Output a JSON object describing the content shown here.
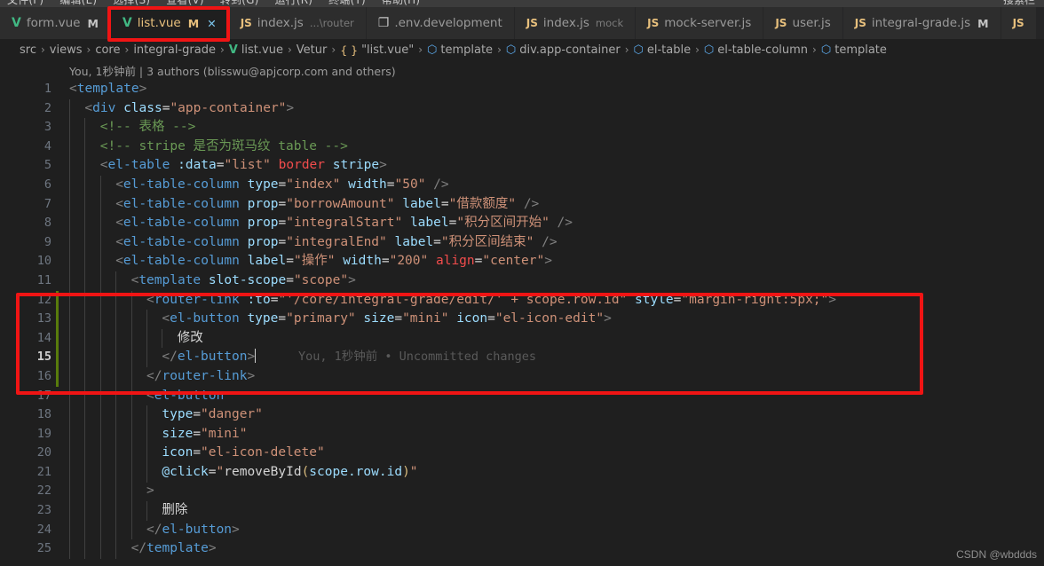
{
  "menubar": {
    "items": [
      "文件(F)",
      "编辑(E)",
      "选择(S)",
      "查看(V)",
      "转到(G)",
      "运行(R)",
      "终端(T)",
      "帮助(H)"
    ],
    "right_label": "搜索栏"
  },
  "tabs": [
    {
      "icon": "vue-icon",
      "name": "form.vue",
      "desc": "",
      "dirty": "M",
      "active": false,
      "closable": false
    },
    {
      "icon": "vue-icon",
      "name": "list.vue",
      "desc": "",
      "dirty": "M",
      "active": true,
      "closable": true,
      "close_label": "✕"
    },
    {
      "icon": "js-icon",
      "name": "index.js",
      "desc": "...\\router",
      "dirty": "",
      "active": false,
      "closable": false
    },
    {
      "icon": "file-icon",
      "name": ".env.development",
      "desc": "",
      "dirty": "",
      "active": false,
      "closable": false
    },
    {
      "icon": "js-icon",
      "name": "index.js",
      "desc": "mock",
      "dirty": "",
      "active": false,
      "closable": false
    },
    {
      "icon": "js-icon",
      "name": "mock-server.js",
      "desc": "",
      "dirty": "",
      "active": false,
      "closable": false
    },
    {
      "icon": "js-icon",
      "name": "user.js",
      "desc": "",
      "dirty": "",
      "active": false,
      "closable": false
    },
    {
      "icon": "js-icon",
      "name": "integral-grade.js",
      "desc": "",
      "dirty": "M",
      "active": false,
      "closable": false
    },
    {
      "icon": "js-icon",
      "name": "",
      "desc": "",
      "dirty": "",
      "active": false,
      "closable": false
    }
  ],
  "breadcrumbs": [
    {
      "glyph": "",
      "label": "src"
    },
    {
      "glyph": "",
      "label": "views"
    },
    {
      "glyph": "",
      "label": "core"
    },
    {
      "glyph": "",
      "label": "integral-grade"
    },
    {
      "glyph": "vue",
      "label": "list.vue"
    },
    {
      "glyph": "",
      "label": "Vetur"
    },
    {
      "glyph": "brace",
      "label": "\"list.vue\""
    },
    {
      "glyph": "cube",
      "label": "template"
    },
    {
      "glyph": "cube",
      "label": "div.app-container"
    },
    {
      "glyph": "cube",
      "label": "el-table"
    },
    {
      "glyph": "cube",
      "label": "el-table-column"
    },
    {
      "glyph": "cube",
      "label": "template"
    }
  ],
  "breadcrumb_separator": "›",
  "blame": {
    "text": "You, 1秒钟前 | 3 authors (blisswu@apjcorp.com and others)"
  },
  "editor": {
    "inline_blame": "You, 1秒钟前 • Uncommitted changes",
    "current_line": 15,
    "lines": [
      {
        "n": 1,
        "git": false,
        "indent": 0,
        "tokens": [
          {
            "c": "brk",
            "t": "<"
          },
          {
            "c": "tag",
            "t": "template"
          },
          {
            "c": "brk",
            "t": ">"
          }
        ]
      },
      {
        "n": 2,
        "git": false,
        "indent": 1,
        "tokens": [
          {
            "c": "brk",
            "t": "<"
          },
          {
            "c": "tag",
            "t": "div"
          },
          {
            "c": "txt",
            "t": " "
          },
          {
            "c": "attr",
            "t": "class"
          },
          {
            "c": "op",
            "t": "="
          },
          {
            "c": "str",
            "t": "\"app-container\""
          },
          {
            "c": "brk",
            "t": ">"
          }
        ]
      },
      {
        "n": 3,
        "git": false,
        "indent": 2,
        "tokens": [
          {
            "c": "cmt",
            "t": "<!-- 表格 -->"
          }
        ]
      },
      {
        "n": 4,
        "git": false,
        "indent": 2,
        "tokens": [
          {
            "c": "cmt",
            "t": "<!-- stripe 是否为斑马纹 table -->"
          }
        ]
      },
      {
        "n": 5,
        "git": false,
        "indent": 2,
        "tokens": [
          {
            "c": "brk",
            "t": "<"
          },
          {
            "c": "tag",
            "t": "el-table"
          },
          {
            "c": "txt",
            "t": " "
          },
          {
            "c": "attr",
            "t": ":data"
          },
          {
            "c": "op",
            "t": "="
          },
          {
            "c": "str",
            "t": "\"list\""
          },
          {
            "c": "txt",
            "t": " "
          },
          {
            "c": "attr2",
            "t": "border"
          },
          {
            "c": "txt",
            "t": " "
          },
          {
            "c": "attr",
            "t": "stripe"
          },
          {
            "c": "brk",
            "t": ">"
          }
        ]
      },
      {
        "n": 6,
        "git": false,
        "indent": 3,
        "tokens": [
          {
            "c": "brk",
            "t": "<"
          },
          {
            "c": "tag",
            "t": "el-table-column"
          },
          {
            "c": "txt",
            "t": " "
          },
          {
            "c": "attr",
            "t": "type"
          },
          {
            "c": "op",
            "t": "="
          },
          {
            "c": "str",
            "t": "\"index\""
          },
          {
            "c": "txt",
            "t": " "
          },
          {
            "c": "attr",
            "t": "width"
          },
          {
            "c": "op",
            "t": "="
          },
          {
            "c": "str",
            "t": "\"50\""
          },
          {
            "c": "txt",
            "t": " "
          },
          {
            "c": "brk",
            "t": "/>"
          }
        ]
      },
      {
        "n": 7,
        "git": false,
        "indent": 3,
        "tokens": [
          {
            "c": "brk",
            "t": "<"
          },
          {
            "c": "tag",
            "t": "el-table-column"
          },
          {
            "c": "txt",
            "t": " "
          },
          {
            "c": "attr",
            "t": "prop"
          },
          {
            "c": "op",
            "t": "="
          },
          {
            "c": "str",
            "t": "\"borrowAmount\""
          },
          {
            "c": "txt",
            "t": " "
          },
          {
            "c": "attr",
            "t": "label"
          },
          {
            "c": "op",
            "t": "="
          },
          {
            "c": "str",
            "t": "\"借款额度\""
          },
          {
            "c": "txt",
            "t": " "
          },
          {
            "c": "brk",
            "t": "/>"
          }
        ]
      },
      {
        "n": 8,
        "git": false,
        "indent": 3,
        "tokens": [
          {
            "c": "brk",
            "t": "<"
          },
          {
            "c": "tag",
            "t": "el-table-column"
          },
          {
            "c": "txt",
            "t": " "
          },
          {
            "c": "attr",
            "t": "prop"
          },
          {
            "c": "op",
            "t": "="
          },
          {
            "c": "str",
            "t": "\"integralStart\""
          },
          {
            "c": "txt",
            "t": " "
          },
          {
            "c": "attr",
            "t": "label"
          },
          {
            "c": "op",
            "t": "="
          },
          {
            "c": "str",
            "t": "\"积分区间开始\""
          },
          {
            "c": "txt",
            "t": " "
          },
          {
            "c": "brk",
            "t": "/>"
          }
        ]
      },
      {
        "n": 9,
        "git": false,
        "indent": 3,
        "tokens": [
          {
            "c": "brk",
            "t": "<"
          },
          {
            "c": "tag",
            "t": "el-table-column"
          },
          {
            "c": "txt",
            "t": " "
          },
          {
            "c": "attr",
            "t": "prop"
          },
          {
            "c": "op",
            "t": "="
          },
          {
            "c": "str",
            "t": "\"integralEnd\""
          },
          {
            "c": "txt",
            "t": " "
          },
          {
            "c": "attr",
            "t": "label"
          },
          {
            "c": "op",
            "t": "="
          },
          {
            "c": "str",
            "t": "\"积分区间结束\""
          },
          {
            "c": "txt",
            "t": " "
          },
          {
            "c": "brk",
            "t": "/>"
          }
        ]
      },
      {
        "n": 10,
        "git": false,
        "indent": 3,
        "tokens": [
          {
            "c": "brk",
            "t": "<"
          },
          {
            "c": "tag",
            "t": "el-table-column"
          },
          {
            "c": "txt",
            "t": " "
          },
          {
            "c": "attr",
            "t": "label"
          },
          {
            "c": "op",
            "t": "="
          },
          {
            "c": "str",
            "t": "\"操作\""
          },
          {
            "c": "txt",
            "t": " "
          },
          {
            "c": "attr",
            "t": "width"
          },
          {
            "c": "op",
            "t": "="
          },
          {
            "c": "str",
            "t": "\"200\""
          },
          {
            "c": "txt",
            "t": " "
          },
          {
            "c": "attr2",
            "t": "align"
          },
          {
            "c": "op",
            "t": "="
          },
          {
            "c": "str",
            "t": "\"center\""
          },
          {
            "c": "brk",
            "t": ">"
          }
        ]
      },
      {
        "n": 11,
        "git": false,
        "indent": 4,
        "tokens": [
          {
            "c": "brk",
            "t": "<"
          },
          {
            "c": "tag",
            "t": "template"
          },
          {
            "c": "txt",
            "t": " "
          },
          {
            "c": "attr",
            "t": "slot-scope"
          },
          {
            "c": "op",
            "t": "="
          },
          {
            "c": "str",
            "t": "\"scope\""
          },
          {
            "c": "brk",
            "t": ">"
          }
        ]
      },
      {
        "n": 12,
        "git": true,
        "indent": 5,
        "tokens": [
          {
            "c": "brk",
            "t": "<"
          },
          {
            "c": "tag",
            "t": "router-link"
          },
          {
            "c": "txt",
            "t": " "
          },
          {
            "c": "attr",
            "t": ":to"
          },
          {
            "c": "op",
            "t": "="
          },
          {
            "c": "str",
            "t": "\"'/core/integral-grade/edit/' + scope.row.id\""
          },
          {
            "c": "txt",
            "t": " "
          },
          {
            "c": "attr",
            "t": "style"
          },
          {
            "c": "op",
            "t": "="
          },
          {
            "c": "str",
            "t": "\"margin-right:5px;\""
          },
          {
            "c": "brk",
            "t": ">"
          }
        ]
      },
      {
        "n": 13,
        "git": true,
        "indent": 6,
        "tokens": [
          {
            "c": "brk",
            "t": "<"
          },
          {
            "c": "tag",
            "t": "el-button"
          },
          {
            "c": "txt",
            "t": " "
          },
          {
            "c": "attr",
            "t": "type"
          },
          {
            "c": "op",
            "t": "="
          },
          {
            "c": "str",
            "t": "\"primary\""
          },
          {
            "c": "txt",
            "t": " "
          },
          {
            "c": "attr",
            "t": "size"
          },
          {
            "c": "op",
            "t": "="
          },
          {
            "c": "str",
            "t": "\"mini\""
          },
          {
            "c": "txt",
            "t": " "
          },
          {
            "c": "attr",
            "t": "icon"
          },
          {
            "c": "op",
            "t": "="
          },
          {
            "c": "str",
            "t": "\"el-icon-edit\""
          },
          {
            "c": "brk",
            "t": ">"
          }
        ]
      },
      {
        "n": 14,
        "git": true,
        "indent": 7,
        "tokens": [
          {
            "c": "txt",
            "t": "修改"
          }
        ]
      },
      {
        "n": 15,
        "git": true,
        "indent": 6,
        "tokens": [
          {
            "c": "brk",
            "t": "</"
          },
          {
            "c": "tag",
            "t": "el-button"
          },
          {
            "c": "brk",
            "t": ">"
          }
        ],
        "caret": true,
        "blame": true
      },
      {
        "n": 16,
        "git": true,
        "indent": 5,
        "tokens": [
          {
            "c": "brk",
            "t": "</"
          },
          {
            "c": "tag",
            "t": "router-link"
          },
          {
            "c": "brk",
            "t": ">"
          }
        ]
      },
      {
        "n": 17,
        "git": false,
        "indent": 5,
        "tokens": [
          {
            "c": "brk",
            "t": "<"
          },
          {
            "c": "tag",
            "t": "el-button"
          }
        ]
      },
      {
        "n": 18,
        "git": false,
        "indent": 6,
        "tokens": [
          {
            "c": "attr",
            "t": "type"
          },
          {
            "c": "op",
            "t": "="
          },
          {
            "c": "str",
            "t": "\"danger\""
          }
        ]
      },
      {
        "n": 19,
        "git": false,
        "indent": 6,
        "tokens": [
          {
            "c": "attr",
            "t": "size"
          },
          {
            "c": "op",
            "t": "="
          },
          {
            "c": "str",
            "t": "\"mini\""
          }
        ]
      },
      {
        "n": 20,
        "git": false,
        "indent": 6,
        "tokens": [
          {
            "c": "attr",
            "t": "icon"
          },
          {
            "c": "op",
            "t": "="
          },
          {
            "c": "str",
            "t": "\"el-icon-delete\""
          }
        ]
      },
      {
        "n": 21,
        "git": false,
        "indent": 6,
        "tokens": [
          {
            "c": "attr",
            "t": "@click"
          },
          {
            "c": "op",
            "t": "="
          },
          {
            "c": "str",
            "t": "\""
          },
          {
            "c": "txt",
            "t": "removeById"
          },
          {
            "c": "paren",
            "t": "("
          },
          {
            "c": "prop",
            "t": "scope.row.id"
          },
          {
            "c": "paren",
            "t": ")"
          },
          {
            "c": "str",
            "t": "\""
          }
        ]
      },
      {
        "n": 22,
        "git": false,
        "indent": 5,
        "tokens": [
          {
            "c": "brk",
            "t": ">"
          }
        ]
      },
      {
        "n": 23,
        "git": false,
        "indent": 6,
        "tokens": [
          {
            "c": "txt",
            "t": "删除"
          }
        ]
      },
      {
        "n": 24,
        "git": false,
        "indent": 5,
        "tokens": [
          {
            "c": "brk",
            "t": "</"
          },
          {
            "c": "tag",
            "t": "el-button"
          },
          {
            "c": "brk",
            "t": ">"
          }
        ]
      },
      {
        "n": 25,
        "git": false,
        "indent": 4,
        "tokens": [
          {
            "c": "brk",
            "t": "</"
          },
          {
            "c": "tag",
            "t": "template"
          },
          {
            "c": "brk",
            "t": ">"
          }
        ]
      }
    ]
  },
  "annotations": {
    "tab_box_color": "#f01414",
    "code_box_color": "#f01414"
  },
  "watermark": "CSDN @wbddds",
  "colors": {
    "editor_bg": "#1f1f1f",
    "tabbar_bg": "#252526",
    "tab_inactive_bg": "#2d2d2d",
    "git_added": "#587c0c",
    "accent_vue": "#41b883",
    "accent_js": "#e8c07d"
  }
}
